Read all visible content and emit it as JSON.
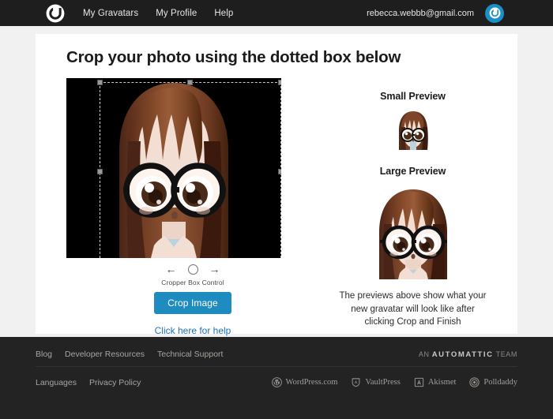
{
  "header": {
    "logo_icon": "gravatar-logo-icon",
    "nav": [
      {
        "label": "My Gravatars"
      },
      {
        "label": "My Profile"
      },
      {
        "label": "Help"
      }
    ],
    "account_email": "rebecca.webbb@gmail.com",
    "avatar_icon": "gravatar-avatar-icon"
  },
  "main": {
    "title": "Crop your photo using the dotted box below",
    "cropper": {
      "left_arrow_icon": "arrow-left-icon",
      "knob_icon": "circle-knob-icon",
      "right_arrow_icon": "arrow-right-icon",
      "control_label": "Cropper Box Control",
      "crop_button": "Crop Image",
      "help_link": "Click here for help"
    },
    "previews": {
      "small_title": "Small Preview",
      "large_title": "Large Preview",
      "note": "The previews above show what your new gravatar will look like after clicking Crop and Finish"
    }
  },
  "footer": {
    "links_row1": [
      {
        "label": "Blog"
      },
      {
        "label": "Developer Resources"
      },
      {
        "label": "Technical Support"
      }
    ],
    "links_row2": [
      {
        "label": "Languages"
      },
      {
        "label": "Privacy Policy"
      }
    ],
    "automattic_prefix": "AN",
    "automattic_name": "AUTOMATTIC",
    "automattic_suffix": "TEAM",
    "brands": [
      {
        "label": "WordPress.com",
        "icon": "wordpress-icon"
      },
      {
        "label": "VaultPress",
        "icon": "vaultpress-icon"
      },
      {
        "label": "Akismet",
        "icon": "akismet-icon"
      },
      {
        "label": "Polldaddy",
        "icon": "polldaddy-icon"
      }
    ]
  },
  "colors": {
    "topbar": "#1e1e1e",
    "footer": "#232323",
    "accent_button": "#1e8cbe",
    "link": "#1e72b8",
    "avatar_blue": "#1b8fc7",
    "page_bg": "#f1f1f1",
    "card_bg": "#ffffff",
    "photo_bg": "#000000"
  }
}
